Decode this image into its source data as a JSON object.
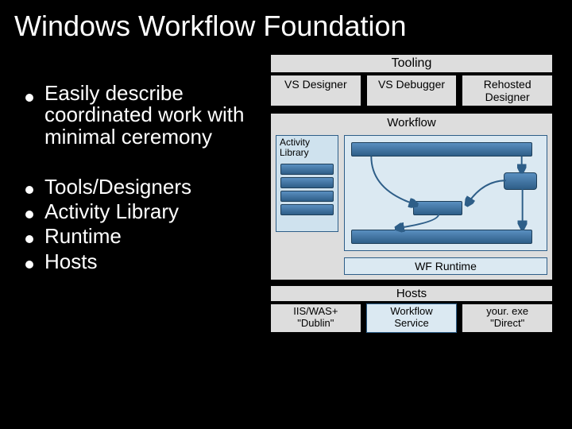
{
  "title": "Windows Workflow Foundation",
  "bullets": {
    "primary": "Easily describe coordinated work with minimal ceremony",
    "list": [
      "Tools/Designers",
      "Activity Library",
      "Runtime",
      "Hosts"
    ]
  },
  "diagram": {
    "tooling": {
      "header": "Tooling",
      "items": [
        "VS Designer",
        "VS Debugger",
        "Rehosted Designer"
      ]
    },
    "workflow": {
      "header": "Workflow",
      "activity_library_label": "Activity Library",
      "runtime_label": "WF Runtime"
    },
    "hosts": {
      "header": "Hosts",
      "items": [
        {
          "line1": "IIS/WAS+",
          "line2": "\"Dublin\""
        },
        {
          "line1": "Workflow",
          "line2": "Service"
        },
        {
          "line1": "your. exe",
          "line2": "\"Direct\""
        }
      ]
    }
  }
}
